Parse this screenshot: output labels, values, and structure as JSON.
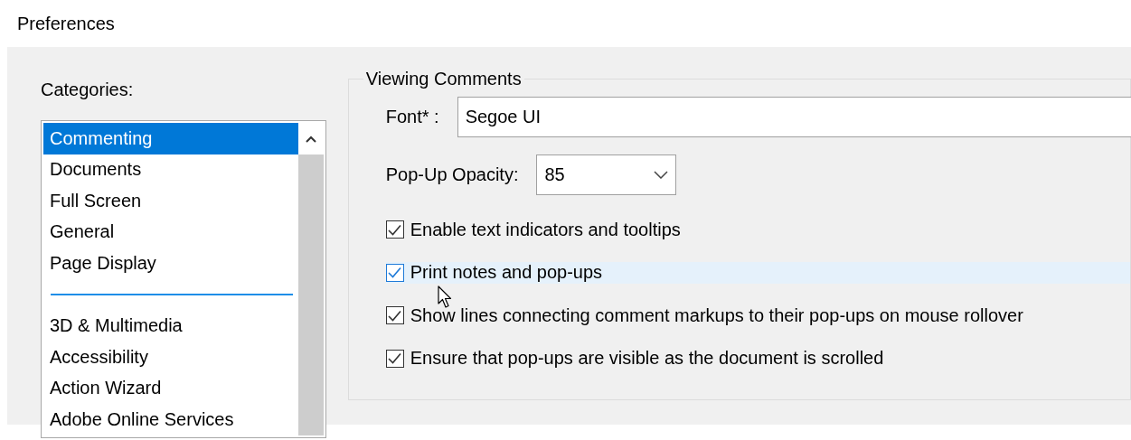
{
  "window": {
    "title": "Preferences"
  },
  "categories": {
    "label": "Categories:",
    "items": [
      {
        "label": "Commenting",
        "selected": true
      },
      {
        "label": "Documents",
        "selected": false
      },
      {
        "label": "Full Screen",
        "selected": false
      },
      {
        "label": "General",
        "selected": false
      },
      {
        "label": "Page Display",
        "selected": false
      },
      {
        "kind": "separator"
      },
      {
        "label": "3D & Multimedia",
        "selected": false
      },
      {
        "label": "Accessibility",
        "selected": false
      },
      {
        "label": "Action Wizard",
        "selected": false
      },
      {
        "label": "Adobe Online Services",
        "selected": false
      }
    ]
  },
  "group": {
    "title": "Viewing Comments",
    "font": {
      "label": "Font* :",
      "value": "Segoe UI"
    },
    "opacity": {
      "label": "Pop-Up Opacity:",
      "value": "85"
    },
    "options": [
      {
        "label": "Enable text indicators and tooltips",
        "checked": true,
        "hovered": false
      },
      {
        "label": "Print notes and pop-ups",
        "checked": true,
        "hovered": true
      },
      {
        "label": "Show lines connecting comment markups to their pop-ups on mouse rollover",
        "checked": true,
        "hovered": false
      },
      {
        "label": "Ensure that pop-ups are visible as the document is scrolled",
        "checked": true,
        "hovered": false
      }
    ]
  }
}
